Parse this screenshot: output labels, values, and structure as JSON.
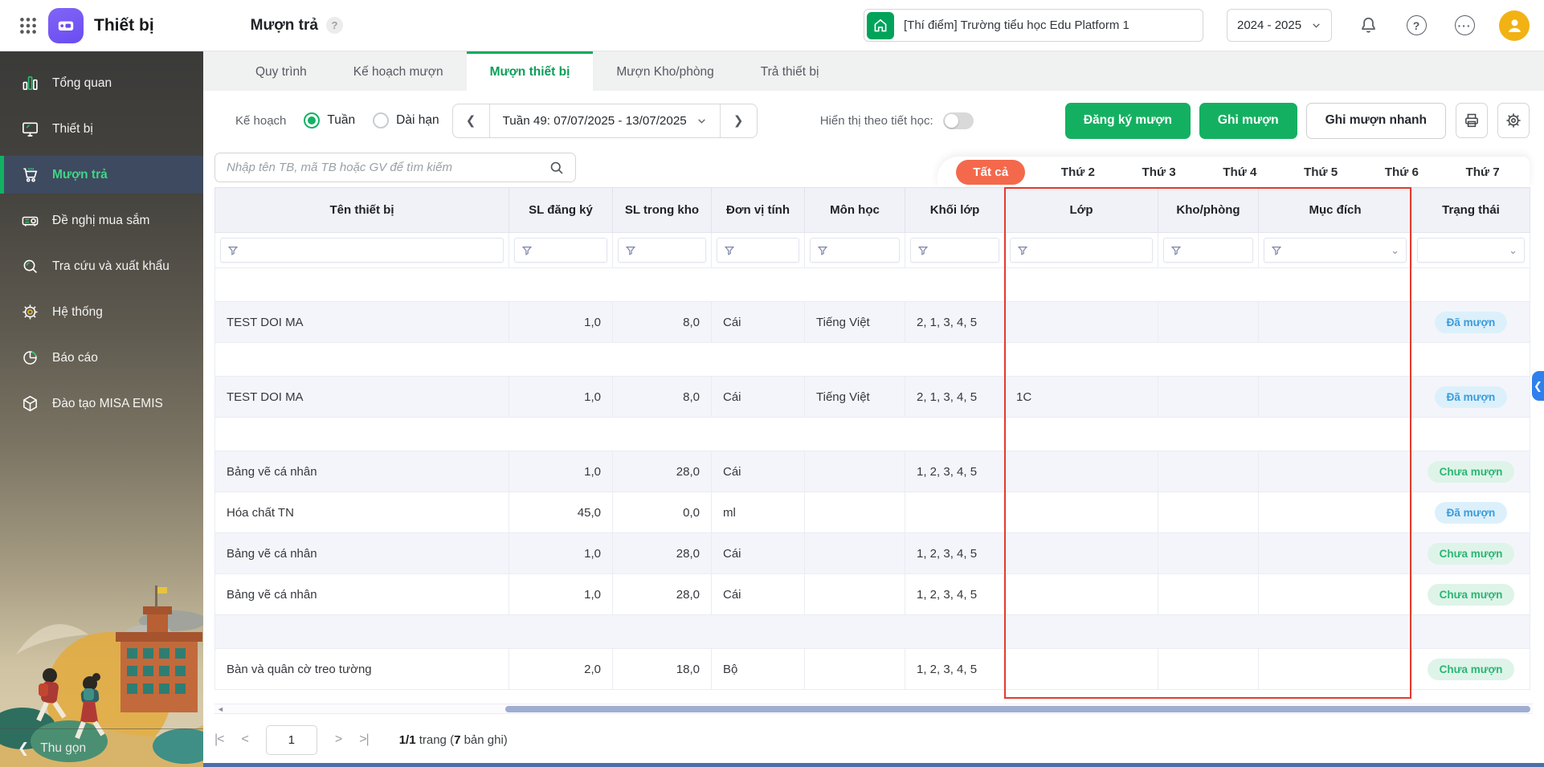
{
  "header": {
    "app_title": "Thiết bị",
    "page_title": "Mượn trả",
    "help_badge": "?",
    "school_name": "[Thí điểm] Trường tiểu học Edu Platform 1",
    "school_year": "2024 - 2025"
  },
  "sidebar": {
    "items": [
      {
        "id": "tong-quan",
        "label": "Tổng quan",
        "icon": "bar-chart-icon",
        "active": false
      },
      {
        "id": "thiet-bi",
        "label": "Thiết bị",
        "icon": "monitor-icon",
        "active": false
      },
      {
        "id": "muon-tra",
        "label": "Mượn trả",
        "icon": "cart-icon",
        "active": true
      },
      {
        "id": "de-nghi-mua-sam",
        "label": "Đề nghị mua sắm",
        "icon": "projector-icon",
        "active": false
      },
      {
        "id": "tra-cuu-va-xuat-khau",
        "label": "Tra cứu và xuất khẩu",
        "icon": "search-icon",
        "active": false
      },
      {
        "id": "he-thong",
        "label": "Hệ thống",
        "icon": "gear-icon",
        "active": false
      },
      {
        "id": "bao-cao",
        "label": "Báo cáo",
        "icon": "pie-chart-icon",
        "active": false
      },
      {
        "id": "dao-tao-misa-emis",
        "label": "Đào tạo MISA EMIS",
        "icon": "cube-icon",
        "active": false
      }
    ],
    "collapse_label": "Thu gọn"
  },
  "tabs": {
    "active_index": 2,
    "items": [
      {
        "id": "quy-trinh",
        "label": "Quy trình"
      },
      {
        "id": "ke-hoach-muon",
        "label": "Kế hoạch mượn"
      },
      {
        "id": "muon-thiet-bi",
        "label": "Mượn thiết bị"
      },
      {
        "id": "muon-kho-phong",
        "label": "Mượn Kho/phòng"
      },
      {
        "id": "tra-thiet-bi",
        "label": "Trả thiết bị"
      }
    ]
  },
  "toolbar": {
    "plan_label": "Kế hoạch",
    "radios": [
      {
        "label": "Tuần",
        "selected": true
      },
      {
        "label": "Dài hạn",
        "selected": false
      }
    ],
    "week_selector": "Tuần 49: 07/07/2025 - 13/07/2025",
    "lesson_toggle_label": "Hiển thị theo tiết học:",
    "lesson_toggle_on": false,
    "buttons": [
      {
        "id": "dang-ky-muon",
        "label": "Đăng ký mượn",
        "style": "primary"
      },
      {
        "id": "ghi-muon",
        "label": "Ghi mượn",
        "style": "primary"
      },
      {
        "id": "ghi-muon-nhanh",
        "label": "Ghi mượn nhanh",
        "style": "secondary"
      }
    ]
  },
  "search": {
    "placeholder": "Nhập tên TB, mã TB hoặc GV để tìm kiếm"
  },
  "day_tabs": {
    "active_index": 0,
    "items": [
      {
        "id": "tat-ca",
        "label": "Tất cả"
      },
      {
        "id": "thu-2",
        "label": "Thứ 2"
      },
      {
        "id": "thu-3",
        "label": "Thứ 3"
      },
      {
        "id": "thu-4",
        "label": "Thứ 4"
      },
      {
        "id": "thu-5",
        "label": "Thứ 5"
      },
      {
        "id": "thu-6",
        "label": "Thứ 6"
      },
      {
        "id": "thu-7",
        "label": "Thứ 7"
      }
    ]
  },
  "table": {
    "columns": [
      {
        "label": "Tên thiết bị",
        "filter": "funnel"
      },
      {
        "label": "SL đăng ký",
        "filter": "funnel"
      },
      {
        "label": "SL trong kho",
        "filter": "funnel"
      },
      {
        "label": "Đơn vị tính",
        "filter": "funnel"
      },
      {
        "label": "Môn học",
        "filter": "funnel"
      },
      {
        "label": "Khối lớp",
        "filter": "funnel"
      },
      {
        "label": "Lớp",
        "filter": "funnel"
      },
      {
        "label": "Kho/phòng",
        "filter": "funnel"
      },
      {
        "label": "Mục đích",
        "filter": "funnel-dropdown"
      },
      {
        "label": "Trạng thái",
        "filter": "dropdown"
      }
    ],
    "rows": [
      {
        "empty": true
      },
      {
        "cells": [
          "TEST DOI MA",
          "1,0",
          "8,0",
          "Cái",
          "Tiếng Việt",
          "2, 1, 3, 4, 5",
          "",
          "",
          ""
        ],
        "status": "Đã mượn",
        "status_color": "blue"
      },
      {
        "empty": true
      },
      {
        "cells": [
          "TEST DOI MA",
          "1,0",
          "8,0",
          "Cái",
          "Tiếng Việt",
          "2, 1, 3, 4, 5",
          "1C",
          "",
          ""
        ],
        "status": "Đã mượn",
        "status_color": "blue"
      },
      {
        "empty": true
      },
      {
        "cells": [
          "Bảng vẽ cá nhân",
          "1,0",
          "28,0",
          "Cái",
          "",
          "1, 2, 3, 4, 5",
          "",
          "",
          ""
        ],
        "status": "Chưa mượn",
        "status_color": "green"
      },
      {
        "cells": [
          "Hóa chất TN",
          "45,0",
          "0,0",
          "ml",
          "",
          "",
          "",
          "",
          ""
        ],
        "status": "Đã mượn",
        "status_color": "blue"
      },
      {
        "cells": [
          "Bảng vẽ cá nhân",
          "1,0",
          "28,0",
          "Cái",
          "",
          "1, 2, 3, 4, 5",
          "",
          "",
          ""
        ],
        "status": "Chưa mượn",
        "status_color": "green"
      },
      {
        "cells": [
          "Bảng vẽ cá nhân",
          "1,0",
          "28,0",
          "Cái",
          "",
          "1, 2, 3, 4, 5",
          "",
          "",
          ""
        ],
        "status": "Chưa mượn",
        "status_color": "green"
      },
      {
        "empty": true
      },
      {
        "cells": [
          "Bàn và quân cờ treo tường",
          "2,0",
          "18,0",
          "Bộ",
          "",
          "1, 2, 3, 4, 5",
          "",
          "",
          ""
        ],
        "status": "Chưa mượn",
        "status_color": "green"
      }
    ]
  },
  "pagination": {
    "current_page": "1",
    "summary_pages": "1/1",
    "summary_mid": " trang (",
    "summary_count": "7",
    "summary_end": " bản ghi)"
  },
  "colors": {
    "accent_green": "#14b061",
    "accent_orange": "#f4694c",
    "highlight_red": "#e23b2e",
    "status_blue_bg": "#dcf0fb",
    "status_blue_text": "#3a9bdb",
    "status_green_bg": "#def4e9",
    "status_green_text": "#2bb673",
    "sidebar_active_bg": "#3e4a5f"
  }
}
